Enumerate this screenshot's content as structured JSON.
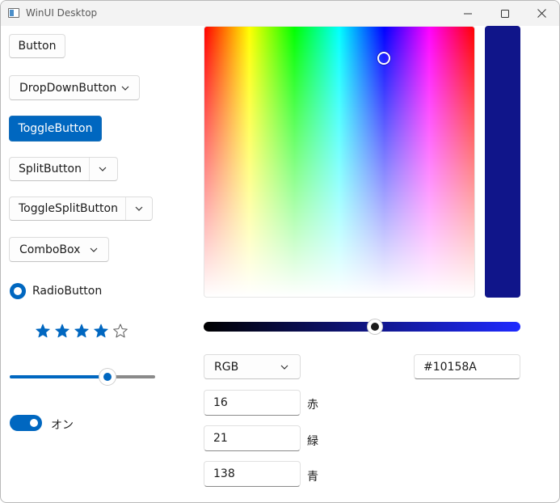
{
  "window": {
    "title": "WinUI Desktop"
  },
  "controls": {
    "button_label": "Button",
    "dropdown_button_label": "DropDownButton",
    "toggle_button_label": "ToggleButton",
    "split_button_label": "SplitButton",
    "toggle_split_button_label": "ToggleSplitButton",
    "combobox_label": "ComboBox",
    "radio_label": "RadioButton",
    "rating": {
      "value": 4,
      "max": 5
    },
    "slider": {
      "value_fraction": 0.67
    },
    "toggle_switch": {
      "on": true,
      "label": "オン"
    }
  },
  "color_picker": {
    "hex": "#10158A",
    "mode": "RGB",
    "channels": [
      {
        "value": "16",
        "label": "赤"
      },
      {
        "value": "21",
        "label": "緑"
      },
      {
        "value": "138",
        "label": "青"
      }
    ],
    "value_slider_fraction": 0.54
  },
  "colors": {
    "accent": "#0067c0",
    "preview": "#10158a",
    "star": "#0067c0"
  },
  "icons": {
    "minimize": "minimize-icon",
    "maximize": "maximize-icon",
    "close": "close-icon",
    "chevron": "chevron-down-icon",
    "star": "star-icon"
  }
}
